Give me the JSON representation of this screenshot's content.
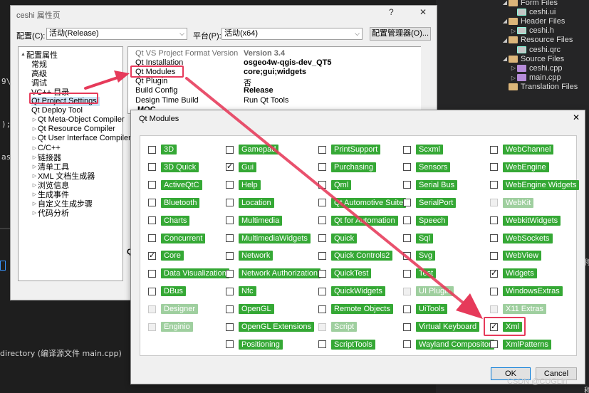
{
  "ide": {
    "code_fragments": [
      "9\\",
      ");",
      "as,"
    ],
    "output_line": "directory (编译源文件 main.cpp)",
    "watermark": "CSDN @CUGLin"
  },
  "solution_explorer": {
    "items": [
      {
        "label": "Form Files",
        "kind": "folder",
        "expanded": true
      },
      {
        "label": "ceshi.ui",
        "kind": "file"
      },
      {
        "label": "Header Files",
        "kind": "folder",
        "expanded": true
      },
      {
        "label": "ceshi.h",
        "kind": "file"
      },
      {
        "label": "Resource Files",
        "kind": "folder",
        "expanded": true
      },
      {
        "label": "ceshi.qrc",
        "kind": "file"
      },
      {
        "label": "Source Files",
        "kind": "folder",
        "expanded": true
      },
      {
        "label": "ceshi.cpp",
        "kind": "cpp"
      },
      {
        "label": "main.cpp",
        "kind": "cpp"
      },
      {
        "label": "Translation Files",
        "kind": "folder",
        "expanded": false
      }
    ],
    "right_edge_labels": [
      "称",
      "称)"
    ]
  },
  "property_dialog": {
    "title": "ceshi 属性页",
    "help_glyph": "?",
    "close_glyph": "✕",
    "config_label": "配置(C):",
    "config_value": "活动(Release)",
    "platform_label": "平台(P):",
    "platform_value": "活动(x64)",
    "config_manager_button": "配置管理器(O)...",
    "tree": [
      {
        "label": "配置属性",
        "level": 0,
        "arrow": "▲"
      },
      {
        "label": "常规",
        "level": 1
      },
      {
        "label": "高级",
        "level": 1
      },
      {
        "label": "调试",
        "level": 1
      },
      {
        "label": "VC++ 目录",
        "level": 1
      },
      {
        "label": "Qt Project Settings",
        "level": 1,
        "selected": true
      },
      {
        "label": "Qt Deploy Tool",
        "level": 1
      },
      {
        "label": "Qt Meta-Object Compiler",
        "level": 1,
        "arrow": "▷"
      },
      {
        "label": "Qt Resource Compiler",
        "level": 1,
        "arrow": "▷"
      },
      {
        "label": "Qt User Interface Compiler",
        "level": 1,
        "arrow": "▷"
      },
      {
        "label": "C/C++",
        "level": 1,
        "arrow": "▷"
      },
      {
        "label": "链接器",
        "level": 1,
        "arrow": "▷"
      },
      {
        "label": "清单工具",
        "level": 1,
        "arrow": "▷"
      },
      {
        "label": "XML 文档生成器",
        "level": 1,
        "arrow": "▷"
      },
      {
        "label": "浏览信息",
        "level": 1,
        "arrow": "▷"
      },
      {
        "label": "生成事件",
        "level": 1,
        "arrow": "▷"
      },
      {
        "label": "自定义生成步骤",
        "level": 1,
        "arrow": "▷"
      },
      {
        "label": "代码分析",
        "level": 1,
        "arrow": "▷"
      }
    ],
    "grid": [
      {
        "key": "Qt VS Project Format Version",
        "value": "Version 3.4",
        "gray": true,
        "bold": true
      },
      {
        "key": "Qt Installation",
        "value": "osgeo4w-qgis-dev_QT5",
        "bold": true
      },
      {
        "key": "Qt Modules",
        "value": "core;gui;widgets",
        "bold": true
      },
      {
        "key": "Qt Plugin",
        "value": "否"
      },
      {
        "key": "Build Config",
        "value": "Release",
        "bold": true
      },
      {
        "key": "Design Time Build",
        "value": "Run Qt Tools"
      }
    ],
    "moc_section": "MOC",
    "qt_fragment": "Qt"
  },
  "qt_modules_dialog": {
    "title": "Qt Modules",
    "close_glyph": "✕",
    "columns": [
      [
        {
          "label": "3D",
          "checked": false,
          "enabled": true
        },
        {
          "label": "3D Quick",
          "checked": false,
          "enabled": true
        },
        {
          "label": "ActiveQtC",
          "checked": false,
          "enabled": true
        },
        {
          "label": "Bluetooth",
          "checked": false,
          "enabled": true
        },
        {
          "label": "Charts",
          "checked": false,
          "enabled": true
        },
        {
          "label": "Concurrent",
          "checked": false,
          "enabled": true
        },
        {
          "label": "Core",
          "checked": true,
          "enabled": true
        },
        {
          "label": "Data Visualization",
          "checked": false,
          "enabled": true
        },
        {
          "label": "DBus",
          "checked": false,
          "enabled": true
        },
        {
          "label": "Designer",
          "checked": false,
          "enabled": false
        },
        {
          "label": "Enginio",
          "checked": false,
          "enabled": false
        }
      ],
      [
        {
          "label": "Gamepad",
          "checked": false,
          "enabled": true
        },
        {
          "label": "Gui",
          "checked": true,
          "enabled": true
        },
        {
          "label": "Help",
          "checked": false,
          "enabled": true
        },
        {
          "label": "Location",
          "checked": false,
          "enabled": true
        },
        {
          "label": "Multimedia",
          "checked": false,
          "enabled": true
        },
        {
          "label": "MultimediaWidgets",
          "checked": false,
          "enabled": true
        },
        {
          "label": "Network",
          "checked": false,
          "enabled": true
        },
        {
          "label": "Network Authorization",
          "checked": false,
          "enabled": true
        },
        {
          "label": "Nfc",
          "checked": false,
          "enabled": true
        },
        {
          "label": "OpenGL",
          "checked": false,
          "enabled": true
        },
        {
          "label": "OpenGL Extensions",
          "checked": false,
          "enabled": true
        },
        {
          "label": "Positioning",
          "checked": false,
          "enabled": true
        }
      ],
      [
        {
          "label": "PrintSupport",
          "checked": false,
          "enabled": true
        },
        {
          "label": "Purchasing",
          "checked": false,
          "enabled": true
        },
        {
          "label": "Qml",
          "checked": false,
          "enabled": true
        },
        {
          "label": "Qt Automotive Suite",
          "checked": false,
          "enabled": true
        },
        {
          "label": "Qt for Automation",
          "checked": false,
          "enabled": true
        },
        {
          "label": "Quick",
          "checked": false,
          "enabled": true
        },
        {
          "label": "Quick Controls2",
          "checked": false,
          "enabled": true
        },
        {
          "label": "QuickTest",
          "checked": false,
          "enabled": true
        },
        {
          "label": "QuickWidgets",
          "checked": false,
          "enabled": true
        },
        {
          "label": "Remote Objects",
          "checked": false,
          "enabled": true
        },
        {
          "label": "Script",
          "checked": false,
          "enabled": false
        },
        {
          "label": "ScriptTools",
          "checked": false,
          "enabled": true
        }
      ],
      [
        {
          "label": "Scxml",
          "checked": false,
          "enabled": true
        },
        {
          "label": "Sensors",
          "checked": false,
          "enabled": true
        },
        {
          "label": "Serial Bus",
          "checked": false,
          "enabled": true
        },
        {
          "label": "SerialPort",
          "checked": false,
          "enabled": true
        },
        {
          "label": "Speech",
          "checked": false,
          "enabled": true
        },
        {
          "label": "Sql",
          "checked": false,
          "enabled": true
        },
        {
          "label": "Svg",
          "checked": false,
          "enabled": true
        },
        {
          "label": "Test",
          "checked": false,
          "enabled": true
        },
        {
          "label": "UI Plugin",
          "checked": false,
          "enabled": false
        },
        {
          "label": "UiTools",
          "checked": false,
          "enabled": true
        },
        {
          "label": "Virtual Keyboard",
          "checked": false,
          "enabled": true
        },
        {
          "label": "Wayland Compositor",
          "checked": false,
          "enabled": true
        }
      ],
      [
        {
          "label": "WebChannel",
          "checked": false,
          "enabled": true
        },
        {
          "label": "WebEngine",
          "checked": false,
          "enabled": true
        },
        {
          "label": "WebEngine Widgets",
          "checked": false,
          "enabled": true
        },
        {
          "label": "WebKit",
          "checked": false,
          "enabled": false
        },
        {
          "label": "WebkitWidgets",
          "checked": false,
          "enabled": true
        },
        {
          "label": "WebSockets",
          "checked": false,
          "enabled": true
        },
        {
          "label": "WebView",
          "checked": false,
          "enabled": true
        },
        {
          "label": "Widgets",
          "checked": true,
          "enabled": true
        },
        {
          "label": "WindowsExtras",
          "checked": false,
          "enabled": true
        },
        {
          "label": "X11 Extras",
          "checked": false,
          "enabled": false
        },
        {
          "label": "Xml",
          "checked": true,
          "enabled": true
        },
        {
          "label": "XmlPatterns",
          "checked": false,
          "enabled": true
        }
      ]
    ],
    "ok_label": "OK",
    "cancel_label": "Cancel"
  },
  "colors": {
    "module_tag": "#35a835",
    "highlight": "#e63a5a",
    "selection": "#cce4f7"
  }
}
